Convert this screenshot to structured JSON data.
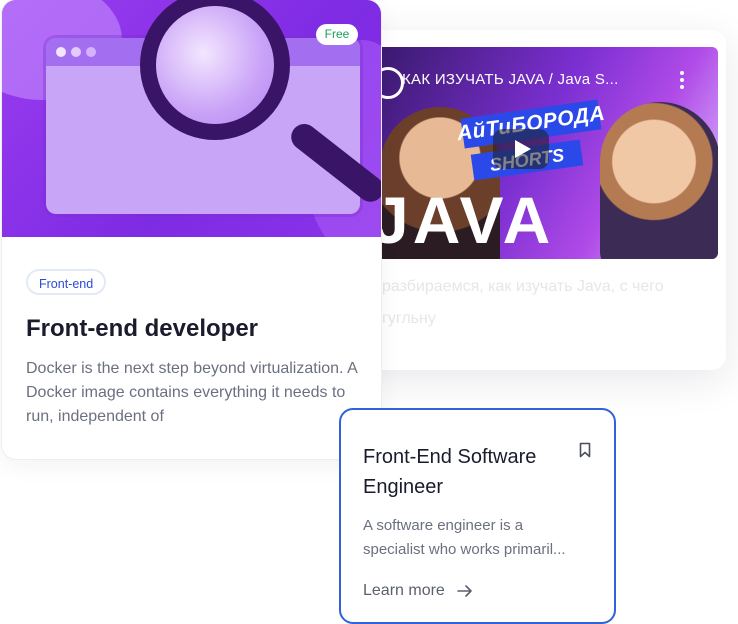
{
  "video": {
    "title": "КАК ИЗУЧАТЬ JAVA / Java S...",
    "brand_line1": "АйТиБОРОДА",
    "brand_line2": "SHORTS",
    "big_word": "JAVA",
    "faded_line1": "разбираемся, как изучать Java, с чего",
    "faded_line2": "гугльну"
  },
  "frontend_card": {
    "badge": "Free",
    "tag": "Front-end",
    "title": "Front-end developer",
    "description": "Docker is the next step beyond virtualization. A Docker image contains everything it needs to run, independent of"
  },
  "engineer_card": {
    "title": "Front-End Software Engineer",
    "description_line1": "A software engineer is a",
    "description_line2": "specialist who works primaril...",
    "cta": "Learn more",
    "icons": {
      "bookmark": "bookmark-icon",
      "arrow": "arrow-right-icon"
    },
    "accent_color": "#2f63d8"
  },
  "colors": {
    "hero_purple": "#8a34ea",
    "free_green": "#1a9e5c",
    "tag_blue": "#2b4bd6"
  }
}
